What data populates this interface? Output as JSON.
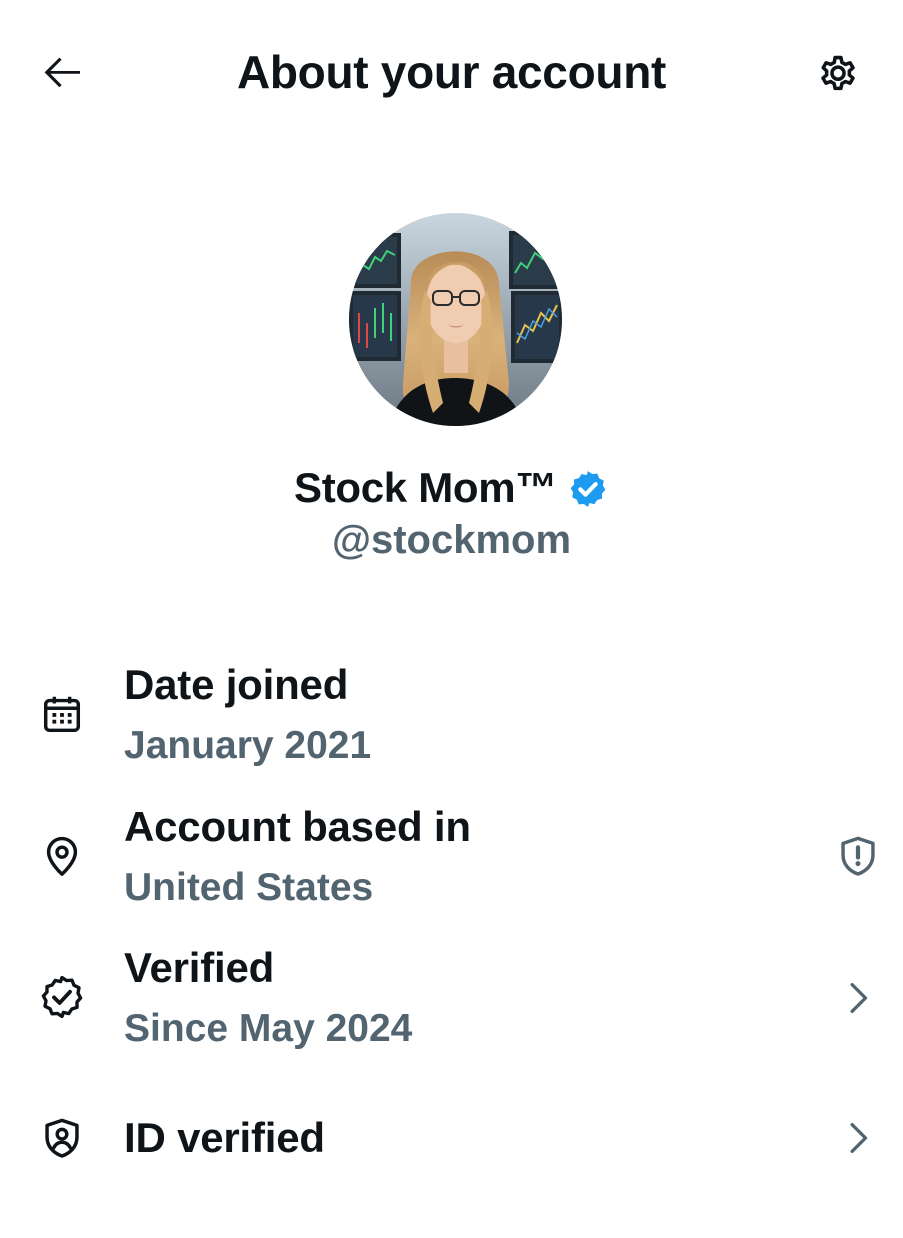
{
  "header": {
    "title": "About your account",
    "back_icon": "arrow-left-icon",
    "settings_icon": "gear-icon"
  },
  "profile": {
    "display_name": "Stock Mom™",
    "handle": "@stockmom",
    "verified_badge_color": "#1d9bf0"
  },
  "info": {
    "date_joined": {
      "label": "Date joined",
      "value": "January 2021",
      "icon": "calendar-icon"
    },
    "account_based_in": {
      "label": "Account based in",
      "value": "United States",
      "icon": "location-pin-icon",
      "trailing_icon": "shield-alert-icon"
    },
    "verified": {
      "label": "Verified",
      "value": "Since May 2024",
      "icon": "verified-seal-icon",
      "trailing_icon": "chevron-right-icon"
    },
    "id_verified": {
      "label": "ID verified",
      "icon": "id-shield-icon",
      "trailing_icon": "chevron-right-icon"
    }
  },
  "colors": {
    "text_primary": "#0f1419",
    "text_secondary": "#536471",
    "accent": "#1d9bf0"
  }
}
